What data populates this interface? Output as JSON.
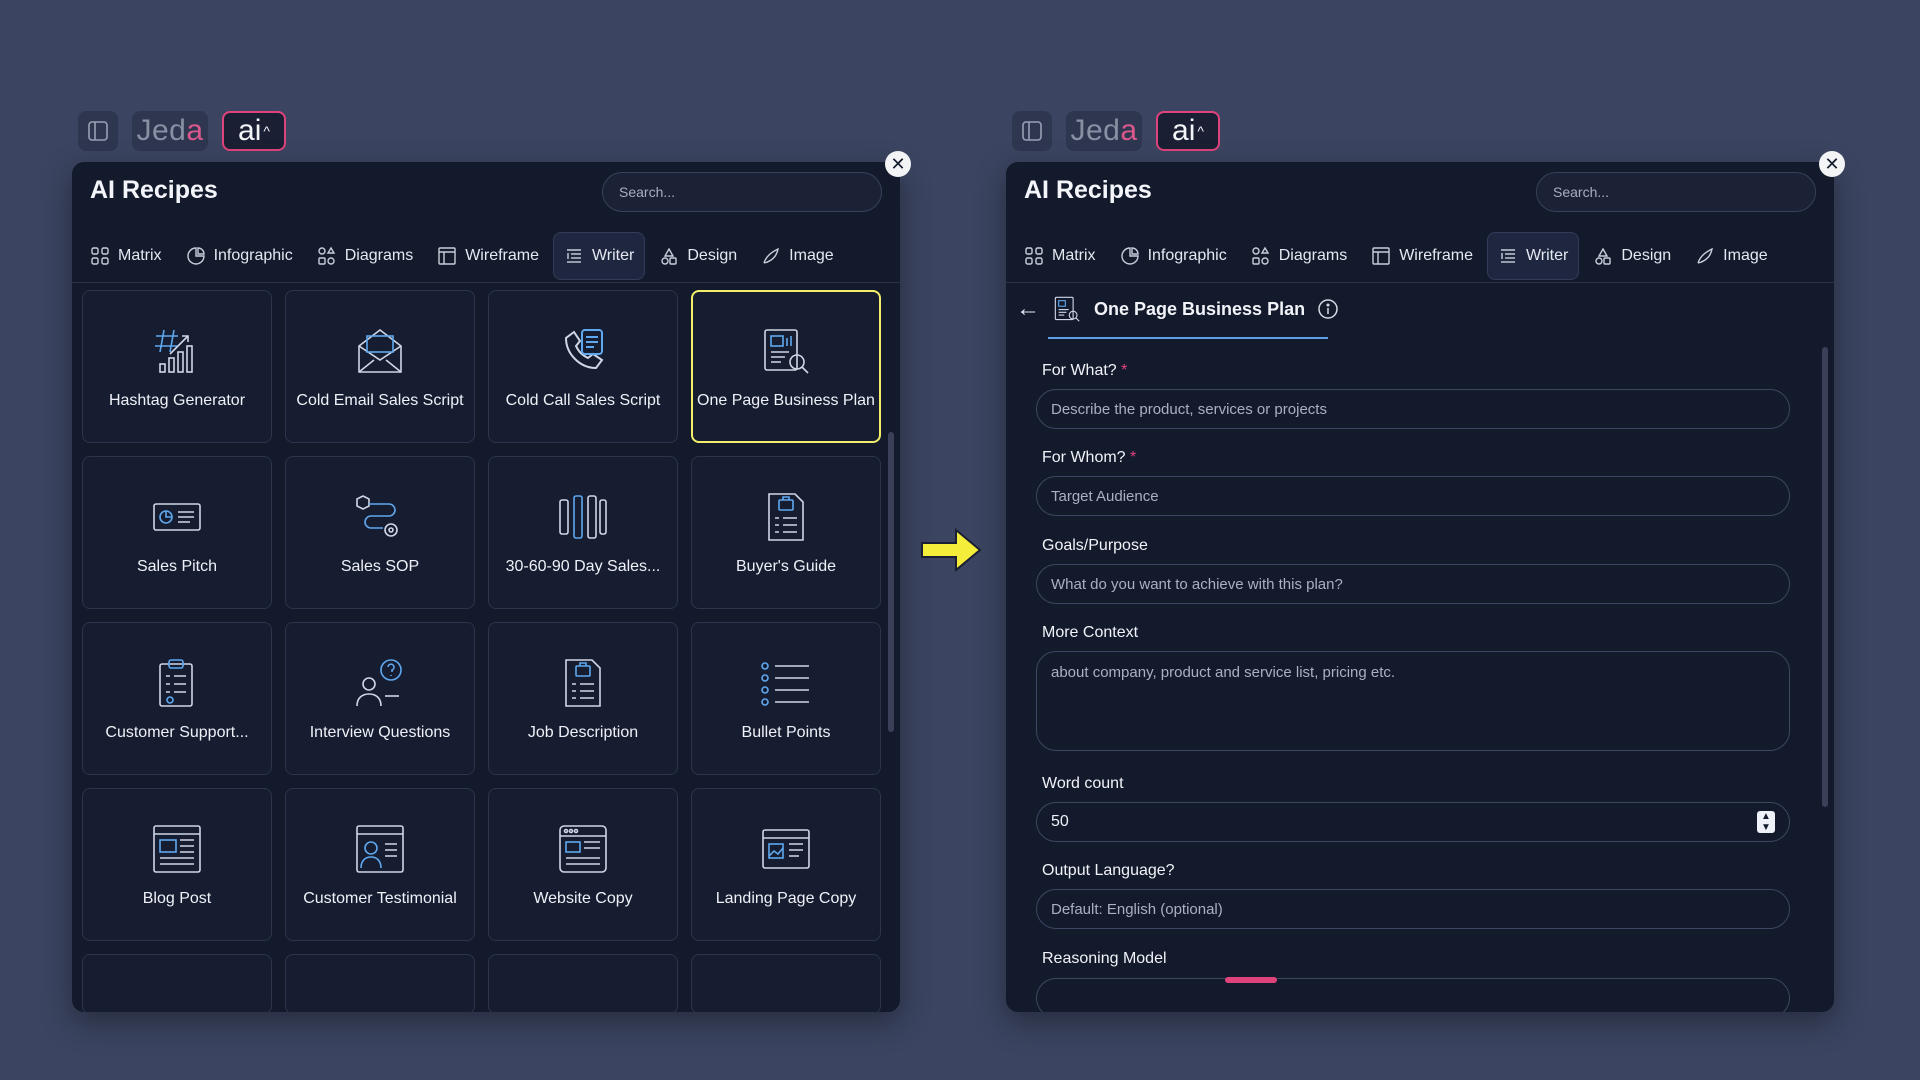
{
  "topbar": {
    "logo": "Jed",
    "logo_accent": "a",
    "ai_label": "ai",
    "caret": "^"
  },
  "panel": {
    "title": "AI Recipes",
    "search_placeholder": "Search...",
    "close": "✕"
  },
  "tabs": [
    {
      "label": "Matrix",
      "icon": "matrix-icon"
    },
    {
      "label": "Infographic",
      "icon": "infographic-icon"
    },
    {
      "label": "Diagrams",
      "icon": "diagrams-icon"
    },
    {
      "label": "Wireframe",
      "icon": "wireframe-icon"
    },
    {
      "label": "Writer",
      "icon": "writer-icon",
      "active": true
    },
    {
      "label": "Design",
      "icon": "design-icon"
    },
    {
      "label": "Image",
      "icon": "image-icon"
    }
  ],
  "recipes": [
    {
      "label": "Hashtag Generator",
      "icon": "hashtag-icon"
    },
    {
      "label": "Cold Email Sales Script",
      "icon": "email-icon"
    },
    {
      "label": "Cold Call Sales Script",
      "icon": "phone-icon"
    },
    {
      "label": "One Page Business Plan",
      "icon": "business-plan-icon",
      "selected": true
    },
    {
      "label": "Sales Pitch",
      "icon": "sales-pitch-icon"
    },
    {
      "label": "Sales SOP",
      "icon": "sales-sop-icon"
    },
    {
      "label": "30-60-90 Day Sales...",
      "icon": "columns-icon"
    },
    {
      "label": "Buyer's Guide",
      "icon": "buyers-guide-icon"
    },
    {
      "label": "Customer Support...",
      "icon": "clipboard-icon"
    },
    {
      "label": "Interview Questions",
      "icon": "interview-icon"
    },
    {
      "label": "Job Description",
      "icon": "job-description-icon"
    },
    {
      "label": "Bullet Points",
      "icon": "bullet-list-icon"
    },
    {
      "label": "Blog Post",
      "icon": "blog-icon"
    },
    {
      "label": "Customer Testimonial",
      "icon": "testimonial-icon"
    },
    {
      "label": "Website Copy",
      "icon": "website-icon"
    },
    {
      "label": "Landing Page Copy",
      "icon": "landing-page-icon"
    }
  ],
  "form": {
    "back": "←",
    "recipe_name": "One Page Business Plan",
    "for_what": {
      "label": "For What?",
      "required": "*",
      "placeholder": "Describe the product, services or projects"
    },
    "for_whom": {
      "label": "For Whom?",
      "required": "*",
      "placeholder": "Target Audience"
    },
    "goals": {
      "label": "Goals/Purpose",
      "placeholder": "What do you want to achieve with this plan?"
    },
    "context": {
      "label": "More Context",
      "placeholder": "about company, product and service list, pricing etc."
    },
    "word_count": {
      "label": "Word count",
      "value": "50"
    },
    "language": {
      "label": "Output Language?",
      "placeholder": "Default: English (optional)"
    },
    "model": {
      "label": "Reasoning Model"
    }
  },
  "colors": {
    "accent": "#e0437c",
    "selected_border": "#f2ee6b",
    "arrow": "#f4ee3a",
    "background": "#3b4460",
    "panel": "#131a2c"
  }
}
